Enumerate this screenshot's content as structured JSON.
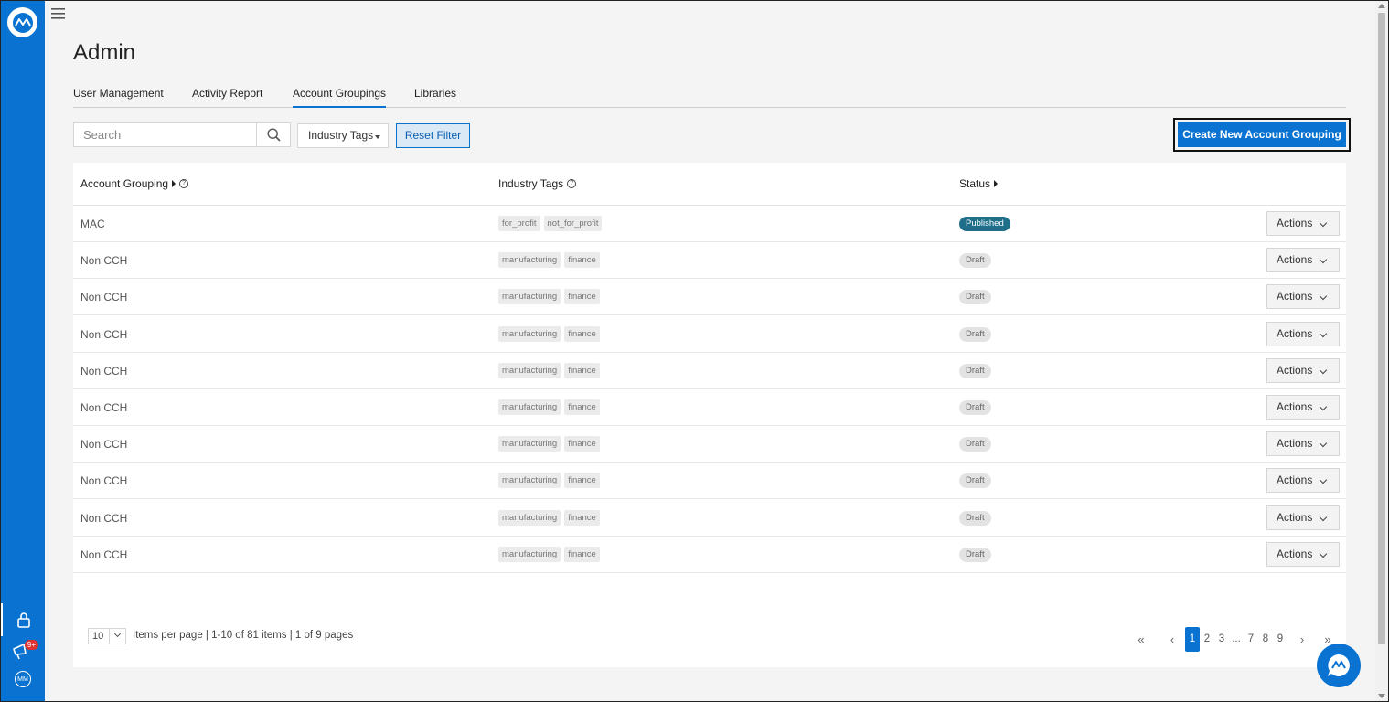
{
  "page_title": "Admin",
  "rail": {
    "logo": "app-logo",
    "lock": "lock-icon",
    "notifications": {
      "icon": "megaphone-icon",
      "badge": "9+"
    },
    "avatar_initials": "MM"
  },
  "tabs": [
    {
      "label": "User Management",
      "active": false
    },
    {
      "label": "Activity Report",
      "active": false
    },
    {
      "label": "Account Groupings",
      "active": true
    },
    {
      "label": "Libraries",
      "active": false
    }
  ],
  "toolbar": {
    "search_placeholder": "Search",
    "filter_label": "Industry Tags",
    "reset_label": "Reset Filter",
    "create_label": "Create New Account Grouping"
  },
  "table": {
    "headers": {
      "name": "Account Grouping",
      "tags": "Industry Tags",
      "status": "Status"
    },
    "action_label": "Actions",
    "rows": [
      {
        "name": "MAC",
        "tags": [
          "for_profit",
          "not_for_profit"
        ],
        "status": "Published"
      },
      {
        "name": "Non CCH",
        "tags": [
          "manufacturing",
          "finance"
        ],
        "status": "Draft"
      },
      {
        "name": "Non CCH",
        "tags": [
          "manufacturing",
          "finance"
        ],
        "status": "Draft"
      },
      {
        "name": "Non CCH",
        "tags": [
          "manufacturing",
          "finance"
        ],
        "status": "Draft"
      },
      {
        "name": "Non CCH",
        "tags": [
          "manufacturing",
          "finance"
        ],
        "status": "Draft"
      },
      {
        "name": "Non CCH",
        "tags": [
          "manufacturing",
          "finance"
        ],
        "status": "Draft"
      },
      {
        "name": "Non CCH",
        "tags": [
          "manufacturing",
          "finance"
        ],
        "status": "Draft"
      },
      {
        "name": "Non CCH",
        "tags": [
          "manufacturing",
          "finance"
        ],
        "status": "Draft"
      },
      {
        "name": "Non CCH",
        "tags": [
          "manufacturing",
          "finance"
        ],
        "status": "Draft"
      },
      {
        "name": "Non CCH",
        "tags": [
          "manufacturing",
          "finance"
        ],
        "status": "Draft"
      }
    ]
  },
  "pagination": {
    "per_page": "10",
    "info": "Items per page | 1-10 of 81 items | 1 of 9 pages",
    "first": "«",
    "prev": "‹",
    "next": "›",
    "last": "»",
    "pages": [
      "1",
      "2",
      "3",
      "...",
      "7",
      "8",
      "9"
    ],
    "current": "1"
  },
  "colors": {
    "brand": "#0a73d1",
    "published": "#1f6f8b",
    "draft": "#e3e3e3"
  }
}
